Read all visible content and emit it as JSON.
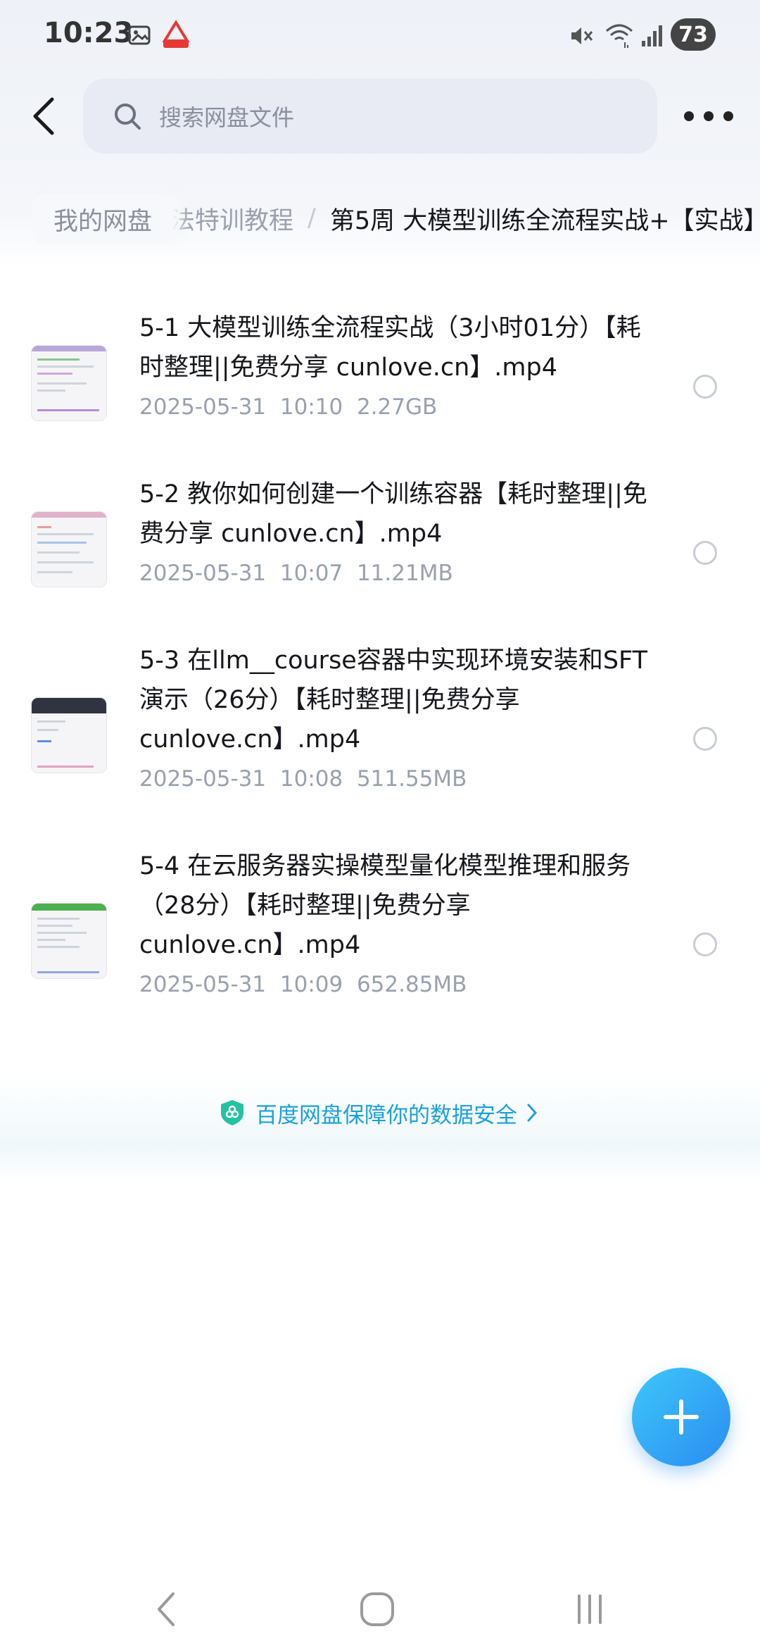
{
  "status_bar": {
    "time": "10:23",
    "battery": "73",
    "icons": [
      "gallery-icon",
      "app-notification-icon",
      "mute-icon",
      "wifi-icon",
      "signal-icon"
    ]
  },
  "top_bar": {
    "back_icon": "chevron-left-icon",
    "search_placeholder": "搜索网盘文件",
    "more_icon": "more-dots-icon"
  },
  "breadcrumb": {
    "root": "我的网盘",
    "middle": "法特训教程",
    "separator": "/",
    "current": "第5周 大模型训练全流程实战+【实战】"
  },
  "files": [
    {
      "name": "5-1 大模型训练全流程实战（3小时01分）【耗时整理||免费分享 cunlove.cn】.mp4",
      "date": "2025-05-31",
      "time": "10:10",
      "size": "2.27GB"
    },
    {
      "name": "5-2 教你如何创建一个训练容器【耗时整理||免费分享 cunlove.cn】.mp4",
      "date": "2025-05-31",
      "time": "10:07",
      "size": "11.21MB"
    },
    {
      "name": "5-3 在llm__course容器中实现环境安装和SFT演示（26分）【耗时整理||免费分享 cunlove.cn】.mp4",
      "date": "2025-05-31",
      "time": "10:08",
      "size": "511.55MB"
    },
    {
      "name": "5-4 在云服务器实操模型量化模型推理和服务（28分）【耗时整理||免费分享 cunlove.cn】.mp4",
      "date": "2025-05-31",
      "time": "10:09",
      "size": "652.85MB"
    }
  ],
  "security_footer": {
    "text": "百度网盘保障你的数据安全",
    "icon": "shield-icon",
    "arrow_icon": "chevron-right-icon"
  },
  "fab": {
    "icon": "plus-icon"
  },
  "nav_bar": {
    "icons": [
      "nav-back-icon",
      "nav-home-icon",
      "nav-recents-icon"
    ]
  },
  "colors": {
    "accent": "#1aa1d9",
    "fab_start": "#3ec7fb",
    "fab_end": "#2a8cf0",
    "meta_text": "#9aa0ae"
  }
}
